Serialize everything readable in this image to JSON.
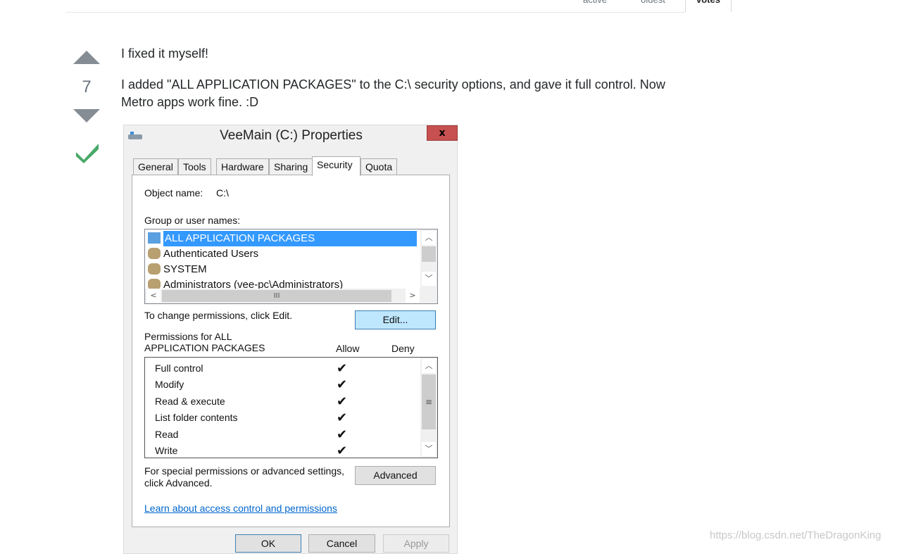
{
  "sort_tabs": [
    {
      "label": "active"
    },
    {
      "label": "oldest"
    },
    {
      "label": "votes"
    }
  ],
  "answer": {
    "score": "7",
    "accepted": true,
    "paragraphs": [
      "I fixed it myself!",
      "I added \"ALL APPLICATION PACKAGES\" to the C:\\ security options, and gave it full control. Now Metro apps work fine. :D"
    ]
  },
  "dialog": {
    "title": "VeeMain (C:) Properties",
    "close_label": "x",
    "tabs": [
      {
        "label": "General"
      },
      {
        "label": "Tools"
      },
      {
        "label": "Hardware"
      },
      {
        "label": "Sharing"
      },
      {
        "label": "Security"
      },
      {
        "label": "Quota"
      }
    ],
    "active_tab": "Security",
    "object_name_label": "Object name:",
    "object_name_value": "C:\\",
    "group_label": "Group or user names:",
    "users": [
      {
        "name": "ALL APPLICATION PACKAGES",
        "selected": true
      },
      {
        "name": "Authenticated Users"
      },
      {
        "name": "SYSTEM"
      },
      {
        "name": "Administrators (vee-pc\\Administrators)"
      }
    ],
    "change_text": "To change permissions, click Edit.",
    "edit_label": "Edit...",
    "perm_header_line1": "Permissions for ALL",
    "perm_header_line2": "APPLICATION PACKAGES",
    "allow_label": "Allow",
    "deny_label": "Deny",
    "check_glyph": "✔",
    "permissions": [
      {
        "name": "Full control",
        "allow": true,
        "deny": false
      },
      {
        "name": "Modify",
        "allow": true,
        "deny": false
      },
      {
        "name": "Read & execute",
        "allow": true,
        "deny": false
      },
      {
        "name": "List folder contents",
        "allow": true,
        "deny": false
      },
      {
        "name": "Read",
        "allow": true,
        "deny": false
      },
      {
        "name": "Write",
        "allow": true,
        "deny": false
      }
    ],
    "special_text_1": "For special permissions or advanced settings,",
    "special_text_2": "click Advanced.",
    "advanced_label": "Advanced",
    "learn_link": "Learn about access control and permissions",
    "ok_label": "OK",
    "cancel_label": "Cancel",
    "apply_label": "Apply",
    "colors": {
      "selection": "#3399ff",
      "edit_button": "#bee6fd",
      "close": "#c75050",
      "link": "#0066cc"
    }
  },
  "watermark": "https://blog.csdn.net/TheDragonKing"
}
